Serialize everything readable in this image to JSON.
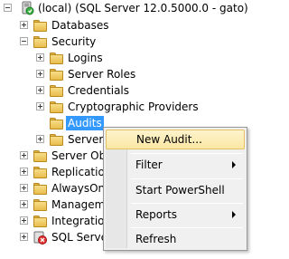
{
  "tree": {
    "server": "(local) (SQL Server 12.0.5000.0 - gato)",
    "databases": "Databases",
    "security": "Security",
    "logins": "Logins",
    "server_roles": "Server Roles",
    "credentials": "Credentials",
    "crypto_providers": "Cryptographic Providers",
    "audits": "Audits",
    "server_audit_specs": "Server",
    "server_objects": "Server Obj",
    "replication": "Replicatio",
    "alwayson": "AlwaysOn",
    "management": "Managem",
    "integration": "Integration",
    "agent": "SQL Serve"
  },
  "menu": {
    "new_audit": "New Audit...",
    "filter": "Filter",
    "start_powershell": "Start PowerShell",
    "reports": "Reports",
    "refresh": "Refresh"
  },
  "colors": {
    "selection": "#3399ff",
    "menu_highlight": "#fbe7a4",
    "folder": "#e9bd4d"
  }
}
